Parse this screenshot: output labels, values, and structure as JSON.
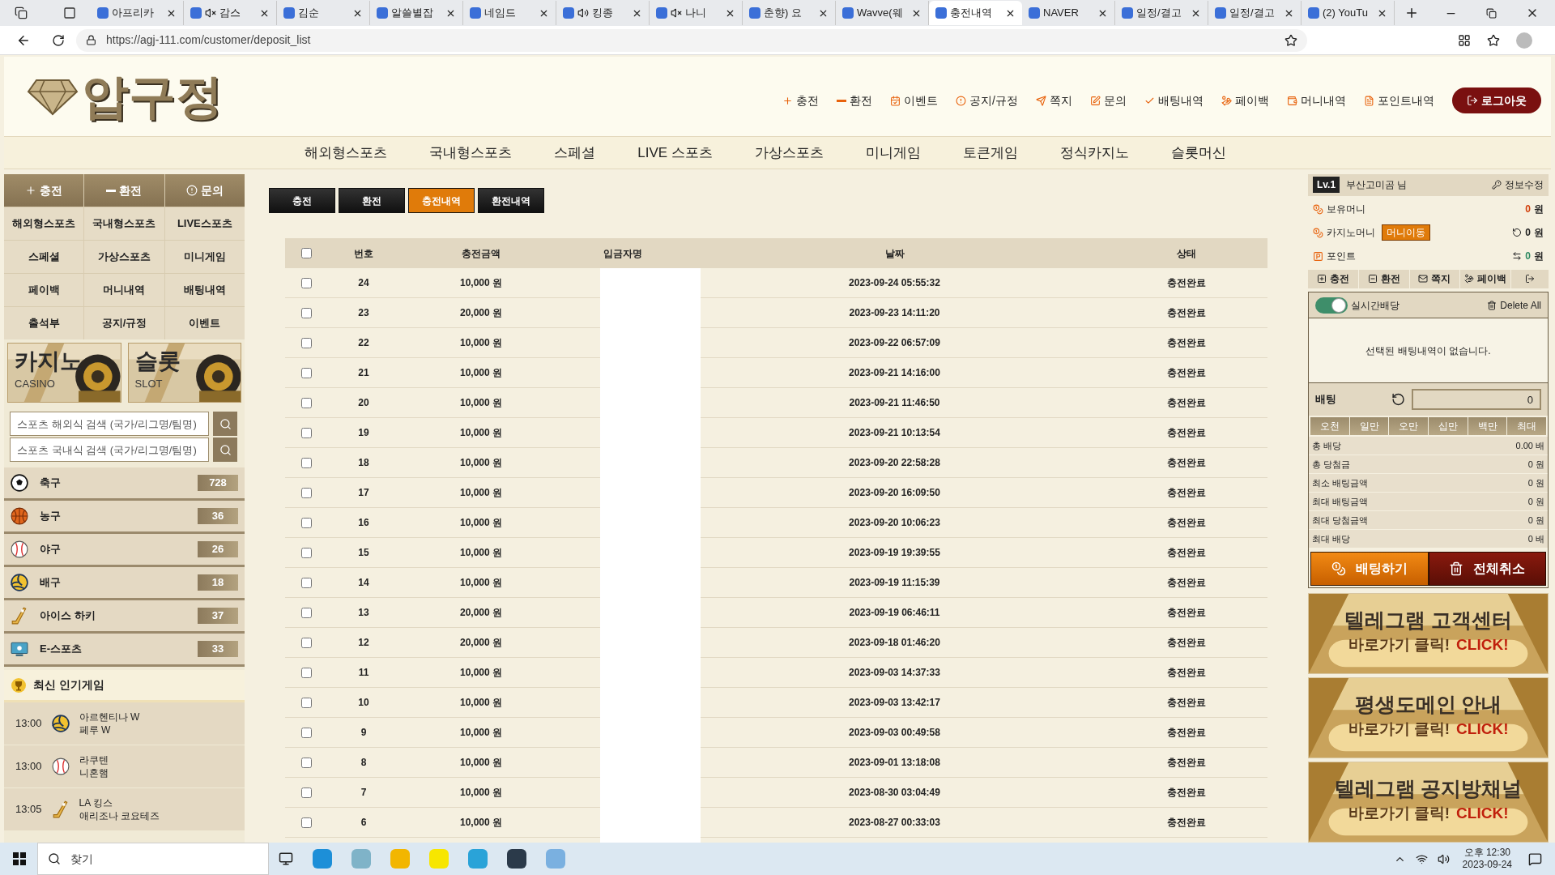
{
  "browser": {
    "tabs": [
      {
        "title": "아프리카",
        "selected": false,
        "kind": "plain"
      },
      {
        "title": "감스",
        "selected": false,
        "kind": "muted"
      },
      {
        "title": "김순",
        "selected": false,
        "kind": "plain"
      },
      {
        "title": "알쓸별잡",
        "selected": false,
        "kind": "plain"
      },
      {
        "title": "네임드",
        "selected": false,
        "kind": "plain"
      },
      {
        "title": "킹종",
        "selected": false,
        "kind": "audio"
      },
      {
        "title": "나니",
        "selected": false,
        "kind": "muted"
      },
      {
        "title": "춘향) 요",
        "selected": false,
        "kind": "plain"
      },
      {
        "title": "Wavve(웨",
        "selected": false,
        "kind": "plain"
      },
      {
        "title": "충전내역",
        "selected": true,
        "kind": "plain"
      },
      {
        "title": "NAVER",
        "selected": false,
        "kind": "plain"
      },
      {
        "title": "일정/결고",
        "selected": false,
        "kind": "plain"
      },
      {
        "title": "일정/결고",
        "selected": false,
        "kind": "plain"
      },
      {
        "title": "(2) YouTu",
        "selected": false,
        "kind": "plain"
      }
    ],
    "url": "https://agj-111.com/customer/deposit_list"
  },
  "header": {
    "logo": "압구정",
    "links": [
      "충전",
      "환전",
      "이벤트",
      "공지/규정",
      "쪽지",
      "문의",
      "배팅내역",
      "페이백",
      "머니내역",
      "포인트내역"
    ],
    "logout": "로그아웃"
  },
  "nav": [
    "해외형스포츠",
    "국내형스포츠",
    "스페셜",
    "LIVE 스포츠",
    "가상스포츠",
    "미니게임",
    "토큰게임",
    "정식카지노",
    "슬롯머신"
  ],
  "sidebar": {
    "top_buttons": [
      "충전",
      "환전",
      "문의"
    ],
    "menu": [
      "해외형스포츠",
      "국내형스포츠",
      "LIVE스포츠",
      "스페셜",
      "가상스포츠",
      "미니게임",
      "페이백",
      "머니내역",
      "배팅내역",
      "출석부",
      "공지/규정",
      "이벤트"
    ],
    "banners": [
      {
        "title": "카지노",
        "subtitle": "CASINO"
      },
      {
        "title": "슬롯",
        "subtitle": "SLOT"
      }
    ],
    "searches": [
      {
        "placeholder": "스포츠 해외식 검색 (국가/리그명/팀명)"
      },
      {
        "placeholder": "스포츠 국내식 검색 (국가/리그명/팀명)"
      }
    ],
    "sports": [
      {
        "name": "축구",
        "count": "728"
      },
      {
        "name": "농구",
        "count": "36"
      },
      {
        "name": "야구",
        "count": "26"
      },
      {
        "name": "배구",
        "count": "18"
      },
      {
        "name": "아이스 하키",
        "count": "37"
      },
      {
        "name": "E-스포츠",
        "count": "33"
      }
    ],
    "popular_title": "최신 인기게임",
    "popular": [
      {
        "time": "13:00",
        "home": "아르헨티나 W",
        "away": "페루 W"
      },
      {
        "time": "13:00",
        "home": "라쿠텐",
        "away": "니혼햄"
      },
      {
        "time": "13:05",
        "home": "LA 킹스",
        "away": "애리조나 코요테즈"
      }
    ]
  },
  "main": {
    "tabs": [
      {
        "label": "충전",
        "selected": false
      },
      {
        "label": "환전",
        "selected": false
      },
      {
        "label": "충전내역",
        "selected": true
      },
      {
        "label": "환전내역",
        "selected": false
      }
    ],
    "table": {
      "select_all": {
        "checked": false
      },
      "columns": [
        "번호",
        "충전금액",
        "입금자명",
        "날짜",
        "상태"
      ],
      "rows": [
        {
          "no": "24",
          "amount": "10,000 원",
          "date": "2023-09-24 05:55:32",
          "status": "충전완료",
          "checked": false
        },
        {
          "no": "23",
          "amount": "20,000 원",
          "date": "2023-09-23 14:11:20",
          "status": "충전완료",
          "checked": false
        },
        {
          "no": "22",
          "amount": "10,000 원",
          "date": "2023-09-22 06:57:09",
          "status": "충전완료",
          "checked": false
        },
        {
          "no": "21",
          "amount": "10,000 원",
          "date": "2023-09-21 14:16:00",
          "status": "충전완료",
          "checked": false
        },
        {
          "no": "20",
          "amount": "10,000 원",
          "date": "2023-09-21 11:46:50",
          "status": "충전완료",
          "checked": false
        },
        {
          "no": "19",
          "amount": "10,000 원",
          "date": "2023-09-21 10:13:54",
          "status": "충전완료",
          "checked": false
        },
        {
          "no": "18",
          "amount": "10,000 원",
          "date": "2023-09-20 22:58:28",
          "status": "충전완료",
          "checked": false
        },
        {
          "no": "17",
          "amount": "10,000 원",
          "date": "2023-09-20 16:09:50",
          "status": "충전완료",
          "checked": false
        },
        {
          "no": "16",
          "amount": "10,000 원",
          "date": "2023-09-20 10:06:23",
          "status": "충전완료",
          "checked": false
        },
        {
          "no": "15",
          "amount": "10,000 원",
          "date": "2023-09-19 19:39:55",
          "status": "충전완료",
          "checked": false
        },
        {
          "no": "14",
          "amount": "10,000 원",
          "date": "2023-09-19 11:15:39",
          "status": "충전완료",
          "checked": false
        },
        {
          "no": "13",
          "amount": "20,000 원",
          "date": "2023-09-19 06:46:11",
          "status": "충전완료",
          "checked": false
        },
        {
          "no": "12",
          "amount": "20,000 원",
          "date": "2023-09-18 01:46:20",
          "status": "충전완료",
          "checked": false
        },
        {
          "no": "11",
          "amount": "10,000 원",
          "date": "2023-09-03 14:37:33",
          "status": "충전완료",
          "checked": false
        },
        {
          "no": "10",
          "amount": "10,000 원",
          "date": "2023-09-03 13:42:17",
          "status": "충전완료",
          "checked": false
        },
        {
          "no": "9",
          "amount": "10,000 원",
          "date": "2023-09-03 00:49:58",
          "status": "충전완료",
          "checked": false
        },
        {
          "no": "8",
          "amount": "10,000 원",
          "date": "2023-09-01 13:18:08",
          "status": "충전완료",
          "checked": false
        },
        {
          "no": "7",
          "amount": "10,000 원",
          "date": "2023-08-30 03:04:49",
          "status": "충전완료",
          "checked": false
        },
        {
          "no": "6",
          "amount": "10,000 원",
          "date": "2023-08-27 00:33:03",
          "status": "충전완료",
          "checked": false
        }
      ]
    }
  },
  "account": {
    "level": "Lv.1",
    "user": "부산고미곰 님",
    "edit": "정보수정",
    "balances": [
      {
        "label": "보유머니",
        "value": "0",
        "unit": "원"
      },
      {
        "label": "카지노머니",
        "value": "0",
        "unit": "원",
        "action": "머니이동"
      },
      {
        "label": "포인트",
        "value": "0",
        "unit": "원"
      }
    ],
    "buttons": [
      "충전",
      "환전",
      "쪽지",
      "페이백"
    ]
  },
  "betslip": {
    "live_odds": {
      "label": "실시간배당",
      "on": true
    },
    "delete_all": "Delete All",
    "empty": "선택된 배팅내역이 없습니다.",
    "bet_label": "배팅",
    "bet_value": "0",
    "chips": [
      "오천",
      "일만",
      "오만",
      "십만",
      "백만",
      "최대"
    ],
    "summary": [
      {
        "label": "총 배당",
        "value": "0.00 배"
      },
      {
        "label": "총 당첨금",
        "value": "0 원"
      },
      {
        "label": "최소 배팅금액",
        "value": "0 원"
      },
      {
        "label": "최대 배팅금액",
        "value": "0 원"
      },
      {
        "label": "최대 당첨금액",
        "value": "0 원"
      },
      {
        "label": "최대 배당",
        "value": "0 배"
      }
    ],
    "place": "배팅하기",
    "cancel": "전체취소"
  },
  "promos": [
    {
      "title": "텔레그램 고객센터",
      "cta": "바로가기 클릭!",
      "cta_en": "CLICK!"
    },
    {
      "title": "평생도메인 안내",
      "cta": "바로가기 클릭!",
      "cta_en": "CLICK!"
    },
    {
      "title": "텔레그램 공지방채널",
      "cta": "바로가기 클릭!",
      "cta_en": "CLICK!"
    }
  ],
  "taskbar": {
    "search_placeholder": "찾기",
    "time": "오후 12:30",
    "date": "2023-09-24"
  }
}
